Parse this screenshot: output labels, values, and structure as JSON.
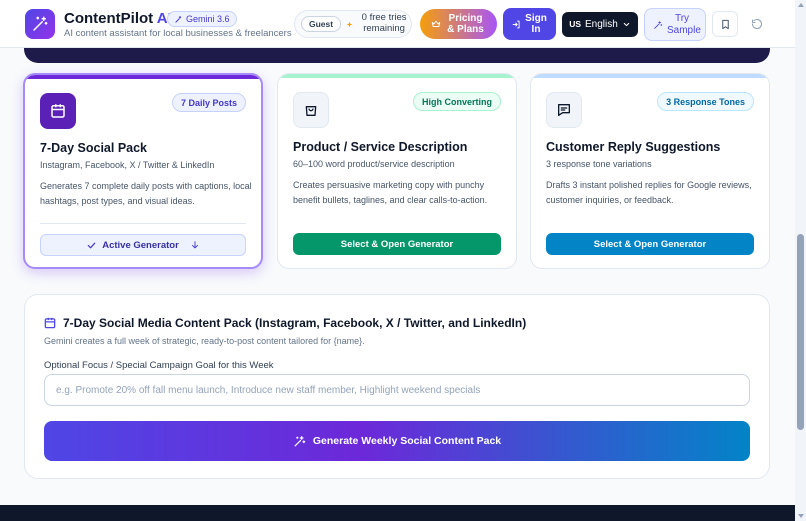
{
  "header": {
    "brand_name": "ContentPilot",
    "brand_ai": "AI",
    "tagline": "AI content assistant for local businesses & freelancers",
    "model_badge": "Gemini 3.6",
    "guest_label": "Guest",
    "tries_text": "0 free tries remaining",
    "pricing_label": "Pricing & Plans",
    "signin_label": "Sign In",
    "lang_flag": "US",
    "lang_label": "English",
    "try_sample_label": "Try Sample"
  },
  "cards": [
    {
      "badge": "7 Daily Posts",
      "title": "7-Day Social Pack",
      "subtitle": "Instagram, Facebook, X / Twitter & LinkedIn",
      "description": "Generates 7 complete daily posts with captions, local hashtags, post types, and visual ideas.",
      "button_label": "Active Generator",
      "active": true
    },
    {
      "badge": "High Converting",
      "title": "Product / Service Description",
      "subtitle": "60–100 word product/service description",
      "description": "Creates persuasive marketing copy with punchy benefit bullets, taglines, and clear calls-to-action.",
      "button_label": "Select & Open Generator",
      "active": false
    },
    {
      "badge": "3 Response Tones",
      "title": "Customer Reply Suggestions",
      "subtitle": "3 response tone variations",
      "description": "Drafts 3 instant polished replies for Google reviews, customer inquiries, or feedback.",
      "button_label": "Select & Open Generator",
      "active": false
    }
  ],
  "form": {
    "title": "7-Day Social Media Content Pack (Instagram, Facebook, X / Twitter, and LinkedIn)",
    "subtitle": "Gemini creates a full week of strategic, ready-to-post content tailored for {name}.",
    "focus_label": "Optional Focus / Special Campaign Goal for this Week",
    "focus_placeholder": "e.g. Promote 20% off fall menu launch, Introduce new staff member, Highlight weekend specials",
    "focus_value": "",
    "generate_label": "Generate Weekly Social Content Pack"
  },
  "colors": {
    "primary": "#4f46e5",
    "green": "#059669",
    "blue": "#0284c7",
    "dark": "#0f172a"
  },
  "icons": {
    "logo": "sparkle-wand-icon",
    "card1": "calendar-icon",
    "card2": "shopping-bag-icon",
    "card3": "message-square-icon"
  }
}
